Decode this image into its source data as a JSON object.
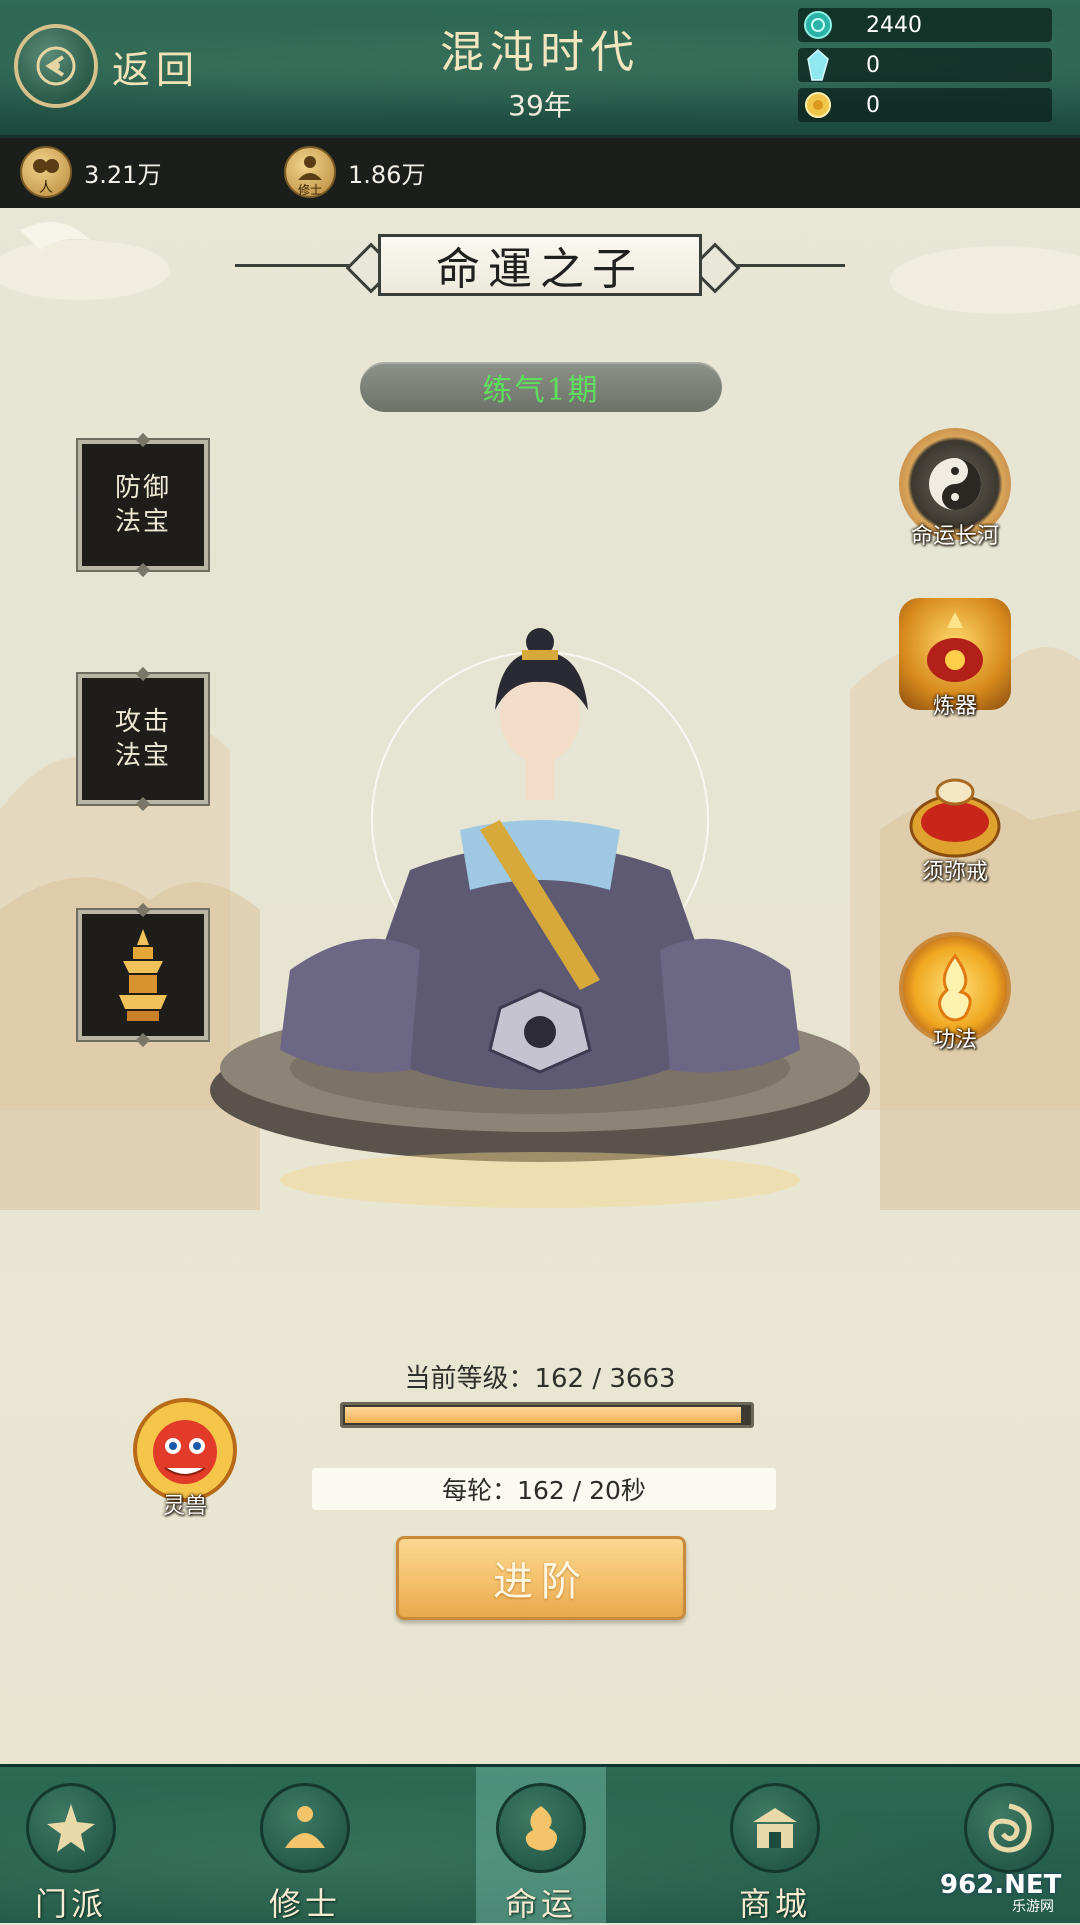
{
  "header": {
    "back_label": "返回",
    "title": "混沌时代",
    "subtitle": "39年",
    "resources": [
      {
        "icon": "spirit-stone-icon",
        "value": "2440"
      },
      {
        "icon": "crystal-icon",
        "value": "0"
      },
      {
        "icon": "gold-ingot-icon",
        "value": "0"
      }
    ]
  },
  "stats": {
    "population_icon_label": "人",
    "population": "3.21万",
    "cultivator_icon_label": "修士",
    "cultivators": "1.86万"
  },
  "banner_title": "命運之子",
  "realm": "练气1期",
  "left_slots": {
    "defense": "防御\n法宝",
    "attack": "攻击\n法宝"
  },
  "right_functions": {
    "destiny_river": "命运长河",
    "refining": "炼器",
    "ring": "须弥戒",
    "technique": "功法"
  },
  "spirit_beast_label": "灵兽",
  "level": {
    "text": "当前等级：162 / 3663",
    "current": 162,
    "max": 3663,
    "bar_fraction": 0.98
  },
  "per_round": "每轮：162 / 20秒",
  "advance_button": "进阶",
  "bottom_nav": [
    {
      "label": "门派",
      "icon": "sect-icon"
    },
    {
      "label": "修士",
      "icon": "cultivator-icon"
    },
    {
      "label": "命运",
      "icon": "destiny-icon",
      "active": true
    },
    {
      "label": "商城",
      "icon": "shop-icon"
    },
    {
      "label": "",
      "icon": "dragon-icon"
    }
  ],
  "watermark": {
    "brand": "962.NET",
    "sub": "乐游网"
  },
  "colors": {
    "realm_text": "#5de15c",
    "header_green": "#2f6b56",
    "progress_fill": "#f2b055"
  }
}
